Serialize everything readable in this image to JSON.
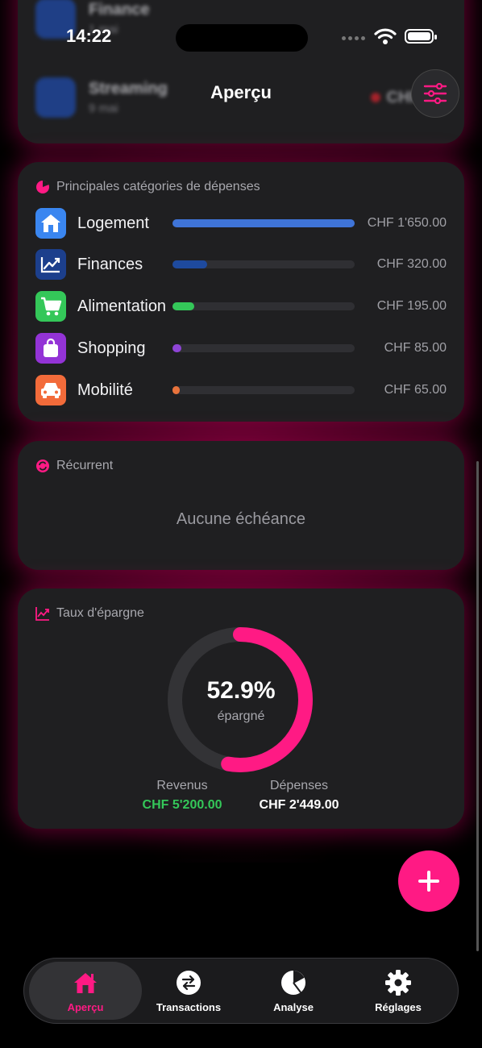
{
  "status_bar": {
    "time": "14:22"
  },
  "nav": {
    "title": "Aperçu"
  },
  "top_card_rows": [
    {
      "title": "Finance",
      "subtitle": "1 mai"
    },
    {
      "title": "Streaming",
      "subtitle": "9 mai",
      "amount": "CHF 2..."
    }
  ],
  "categories_card": {
    "title": "Principales catégories de dépenses",
    "items": [
      {
        "label": "Logement",
        "amount": "CHF 1'650.00",
        "fraction": 1.0,
        "color": "#3f74d8",
        "icon_bg": "#3a86f0",
        "icon": "house-icon"
      },
      {
        "label": "Finances",
        "amount": "CHF 320.00",
        "fraction": 0.19,
        "color": "#1e4a9e",
        "icon_bg": "#1c3f8c",
        "icon": "chart-trend-icon"
      },
      {
        "label": "Alimentation",
        "amount": "CHF 195.00",
        "fraction": 0.12,
        "color": "#34c759",
        "icon_bg": "#34c759",
        "icon": "cart-icon"
      },
      {
        "label": "Shopping",
        "amount": "CHF 85.00",
        "fraction": 0.05,
        "color": "#8e44d6",
        "icon_bg": "#9333d6",
        "icon": "bag-icon"
      },
      {
        "label": "Mobilité",
        "amount": "CHF 65.00",
        "fraction": 0.04,
        "color": "#e8733c",
        "icon_bg": "#f26b3a",
        "icon": "car-icon"
      }
    ]
  },
  "recurring_card": {
    "title": "Récurrent",
    "empty_text": "Aucune échéance"
  },
  "savings_card": {
    "title": "Taux d'épargne",
    "percent_label": "52.9%",
    "percent_value": 52.9,
    "percent_caption": "épargné",
    "income_label": "Revenus",
    "income_value": "CHF 5'200.00",
    "expense_label": "Dépenses",
    "expense_value": "CHF 2'449.00"
  },
  "colors": {
    "accent": "#ff1a84",
    "income": "#34c759"
  },
  "tabs": [
    {
      "label": "Aperçu",
      "icon": "house-icon",
      "active": true
    },
    {
      "label": "Transactions",
      "icon": "arrows-swap-icon",
      "active": false
    },
    {
      "label": "Analyse",
      "icon": "pie-chart-icon",
      "active": false
    },
    {
      "label": "Réglages",
      "icon": "gear-icon",
      "active": false
    }
  ]
}
